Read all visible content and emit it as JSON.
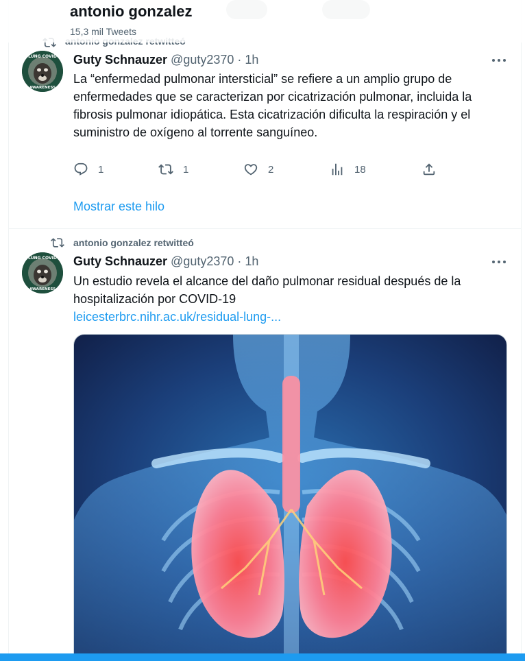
{
  "header": {
    "name": "antonio gonzalez",
    "tweet_count": "15,3 mil Tweets"
  },
  "tweets": [
    {
      "retweeted_by": "antonio gonzalez retwitteó",
      "display_name": "Guty Schnauzer",
      "handle": "@guty2370",
      "time": "· 1h",
      "avatar_text_top": "LUNG COVID",
      "avatar_text_bottom": "AWARENESS",
      "text": "La “enfermedad pulmonar intersticial” se refiere a un amplio grupo de enfermedades que se caracterizan por cicatrización pulmonar, incluida la fibrosis pulmonar idiopática. Esta cicatrización dificulta la respiración y el suministro de oxígeno al torrente sanguíneo.",
      "replies": "1",
      "retweets": "1",
      "likes": "2",
      "views": "18",
      "show_thread": "Mostrar este hilo"
    },
    {
      "retweeted_by": "antonio gonzalez retwitteó",
      "display_name": "Guty Schnauzer",
      "handle": "@guty2370",
      "time": "· 1h",
      "avatar_text_top": "LUNG COVID",
      "avatar_text_bottom": "AWARENESS",
      "text": "Un estudio revela el alcance del daño pulmonar residual después de la hospitalización por COVID-19",
      "link": "leicesterbrc.nihr.ac.uk/residual-lung-..."
    }
  ],
  "colors": {
    "accent": "#1d9bf0",
    "secondary_text": "#536471",
    "primary_text": "#0f1419"
  },
  "icons": {
    "retweet": "retweet-icon",
    "reply": "reply-icon",
    "like": "heart-icon",
    "views": "views-icon",
    "share": "share-icon",
    "more": "more-icon"
  }
}
